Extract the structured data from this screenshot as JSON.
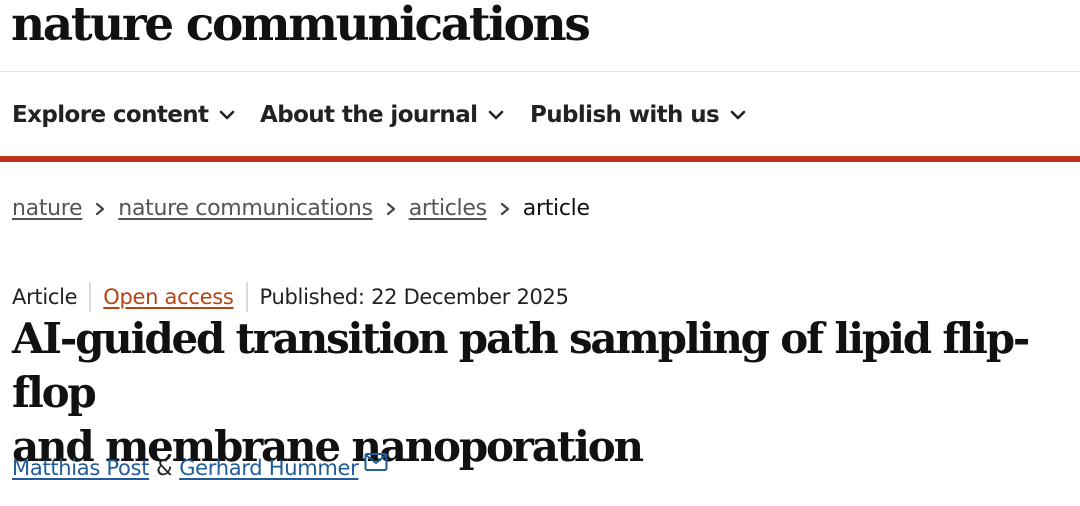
{
  "header": {
    "logo_text": "nature communications"
  },
  "nav": {
    "items": [
      {
        "label": "Explore content",
        "icon": "chevron-down-icon"
      },
      {
        "label": "About the journal",
        "icon": "chevron-down-icon"
      },
      {
        "label": "Publish with us",
        "icon": "chevron-down-icon"
      }
    ],
    "accent_color": "#c0311e"
  },
  "breadcrumb": {
    "items": [
      "nature",
      "nature communications",
      "articles"
    ],
    "current": "article",
    "separator_icon": "chevron-right-icon"
  },
  "article": {
    "type": "Article",
    "access": "Open access",
    "published": "Published: 22 December 2025",
    "title_line1": "AI-guided transition path sampling of lipid flip-flop",
    "title_line2": "and membrane nanoporation",
    "authors": [
      "Matthias Post",
      "Gerhard Hummer"
    ],
    "author_joiner": "&",
    "contact_icon": "envelope-icon",
    "link_color": "#1f5c99",
    "access_color": "#b34513"
  }
}
